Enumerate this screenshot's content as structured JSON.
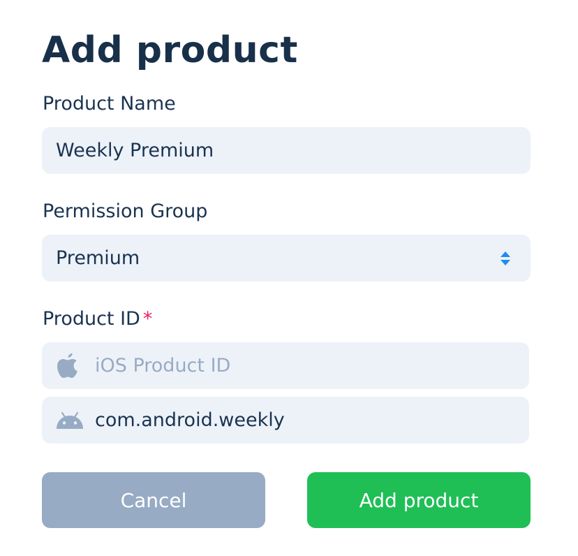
{
  "form": {
    "title": "Add product",
    "product_name": {
      "label": "Product Name",
      "value": "Weekly Premium"
    },
    "permission_group": {
      "label": "Permission Group",
      "selected": "Premium"
    },
    "product_id": {
      "label": "Product ID",
      "required_mark": "*",
      "ios": {
        "placeholder": "iOS Product ID",
        "value": "",
        "icon": "apple-icon"
      },
      "android": {
        "placeholder": "",
        "value": "com.android.weekly",
        "icon": "android-icon"
      }
    },
    "buttons": {
      "cancel_label": "Cancel",
      "submit_label": "Add product"
    }
  },
  "colors": {
    "title": "#183049",
    "text": "#1a3350",
    "field_bg": "#edf2f9",
    "placeholder": "#98abc4",
    "required": "#ea1f5f",
    "select_arrows": "#1e8cf0",
    "cancel_bg": "#97abc4",
    "submit_bg": "#1fbf56",
    "icon_gray": "#98abc4"
  }
}
